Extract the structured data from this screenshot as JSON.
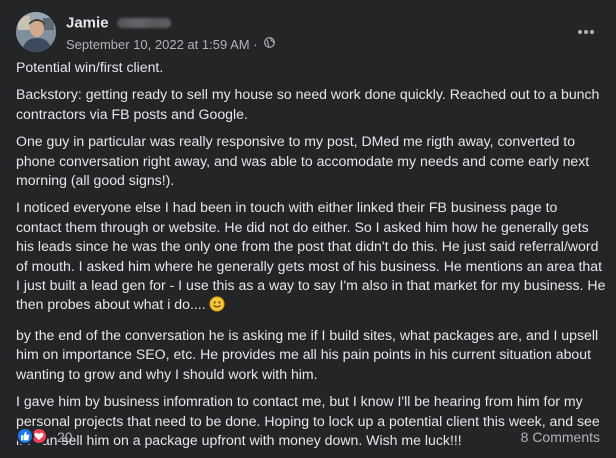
{
  "post": {
    "author": {
      "name": "Jamie",
      "name_redacted": true
    },
    "timestamp": "September 10, 2022 at 1:59 AM",
    "separator": "·",
    "audience_icon": "globe-icon",
    "menu_icon": "more-horizontal-icon",
    "paragraphs": [
      "Potential win/first client.",
      "Backstory: getting ready to sell my house so need work done quickly. Reached out to a bunch contractors via FB posts and Google.",
      "One guy in particular was really responsive to my post, DMed me rigth away, converted to phone conversation right away, and was able to accomodate my needs and come early next morning (all good signs!).",
      "I noticed everyone else I had been in touch with either linked their FB business page to contact them through or website. He did not do either. So I asked him how he generally gets his leads since he was the only one from the post that didn't do this. He just said referral/word of mouth. I asked him where he generally gets most of his business. He mentions an area that I just built a lead gen for - I use this as a way to say I'm also in that market for my business. He then probes about what i do....",
      "by the end of the conversation he is asking me if I build sites, what packages are, and I upsell him on importance SEO, etc. He provides me all his pain points in his current situation about wanting to grow and why I should work with him.",
      "I gave him by business infomration to contact me, but I know I'll be hearing from him for my personal projects that need to be done. Hoping to lock up a potential client this week, and see if I can sell him on a package upfront with money down. Wish me luck!!!"
    ],
    "inline_emoji": "smiling-face-icon",
    "reactions": {
      "types": [
        "like-icon",
        "love-icon"
      ],
      "count": "20"
    },
    "comments_label": "8 Comments",
    "colors": {
      "background": "#242526",
      "text_primary": "#e4e6eb",
      "text_secondary": "#b0b3b8",
      "like_blue": "#1877f2",
      "love_red": "#f33e58"
    }
  }
}
